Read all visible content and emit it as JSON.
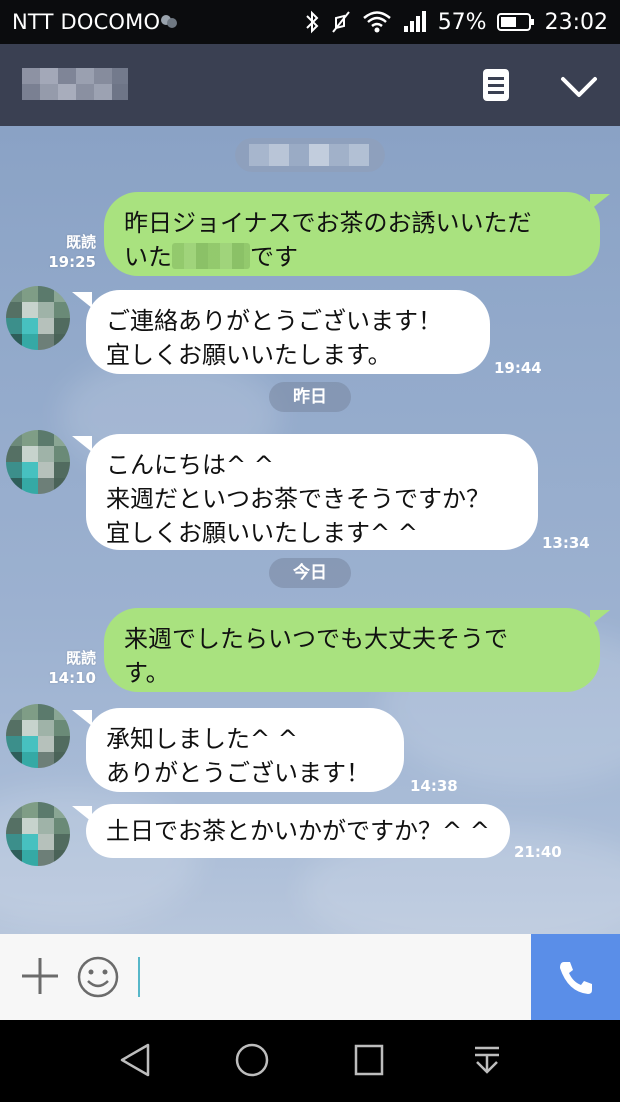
{
  "status_bar": {
    "carrier": "NTT DOCOMO",
    "battery": "57%",
    "time": "23:02",
    "icons": [
      "bluetooth-icon",
      "vibrate-off-icon",
      "wifi-icon",
      "signal-icon",
      "battery-icon"
    ]
  },
  "header": {
    "menu_icon": "notes-icon",
    "collapse_icon": "chevron-down-icon"
  },
  "messages": [
    {
      "side": "right",
      "lines": [
        "昨日ジョイナスでお茶のお誘いいただ",
        "いた",
        "です"
      ],
      "read": "既読",
      "time": "19:25"
    },
    {
      "side": "left",
      "lines": [
        "ご連絡ありがとうございます！",
        "宜しくお願いいたします。"
      ],
      "time": "19:44"
    },
    {
      "side": "left",
      "lines": [
        "こんにちは^ ^",
        "来週だといつお茶できそうですか？",
        "宜しくお願いいたします^ ^"
      ],
      "time": "13:34"
    },
    {
      "side": "right",
      "lines": [
        "来週でしたらいつでも大丈夫そうで",
        "す。"
      ],
      "read": "既読",
      "time": "14:10"
    },
    {
      "side": "left",
      "lines": [
        "承知しました^ ^",
        "ありがとうございます！"
      ],
      "time": "14:38"
    },
    {
      "side": "left",
      "lines": [
        "土日でお茶とかいかがですか？^ ^"
      ],
      "time": "21:40"
    }
  ],
  "separators": [
    "昨日",
    "今日"
  ],
  "input": {
    "value": "",
    "placeholder": ""
  },
  "colors": {
    "outgoing_bubble": "#a9e27f",
    "incoming_bubble": "#ffffff",
    "header": "#3a4052",
    "call_button": "#5a8ee8"
  }
}
